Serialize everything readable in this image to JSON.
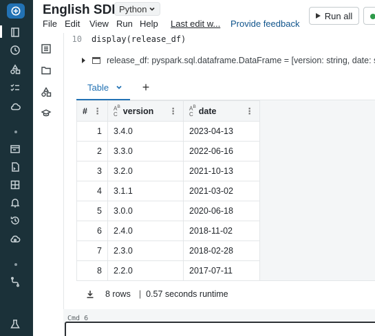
{
  "header": {
    "title": "English SDK",
    "language": "Python",
    "menu": [
      "File",
      "Edit",
      "View",
      "Run",
      "Help"
    ],
    "last_edit": "Last edit w...",
    "feedback": "Provide feedback",
    "run_all": "Run all"
  },
  "cell": {
    "line_number": "10",
    "code": "display(release_df)",
    "df_schema": "release_df:  pyspark.sql.dataframe.DataFrame = [version: string, date: stri"
  },
  "result": {
    "tab_label": "Table",
    "add_tab": "+",
    "columns": [
      "#",
      "version",
      "date"
    ],
    "type_badge": "Aᴮ\nC",
    "rows": [
      {
        "idx": "1",
        "version": "3.4.0",
        "date": "2023-04-13"
      },
      {
        "idx": "2",
        "version": "3.3.0",
        "date": "2022-06-16"
      },
      {
        "idx": "3",
        "version": "3.2.0",
        "date": "2021-10-13"
      },
      {
        "idx": "4",
        "version": "3.1.1",
        "date": "2021-03-02"
      },
      {
        "idx": "5",
        "version": "3.0.0",
        "date": "2020-06-18"
      },
      {
        "idx": "6",
        "version": "2.4.0",
        "date": "2018-11-02"
      },
      {
        "idx": "7",
        "version": "2.3.0",
        "date": "2018-02-28"
      },
      {
        "idx": "8",
        "version": "2.2.0",
        "date": "2017-07-11"
      }
    ],
    "row_count": "8 rows",
    "runtime": "0.57 seconds runtime"
  },
  "next_cell": {
    "cmd_label": "Cmd  6"
  },
  "icons": {
    "rail": [
      "plus-icon",
      "notebook-icon",
      "clock-icon",
      "shapes-icon",
      "checklist-icon",
      "cloud-icon",
      "terminal-icon",
      "file-icon",
      "dashboard-icon",
      "bell-icon",
      "history-icon",
      "cloud-settings-icon",
      "workflow-icon",
      "flask-icon"
    ],
    "side": [
      "toc-icon",
      "folder-icon",
      "shapes-icon",
      "model-icon"
    ]
  },
  "colors": {
    "rail_bg": "#1b3139",
    "accent": "#2272b4",
    "cluster_status": "#2e9a4a"
  }
}
